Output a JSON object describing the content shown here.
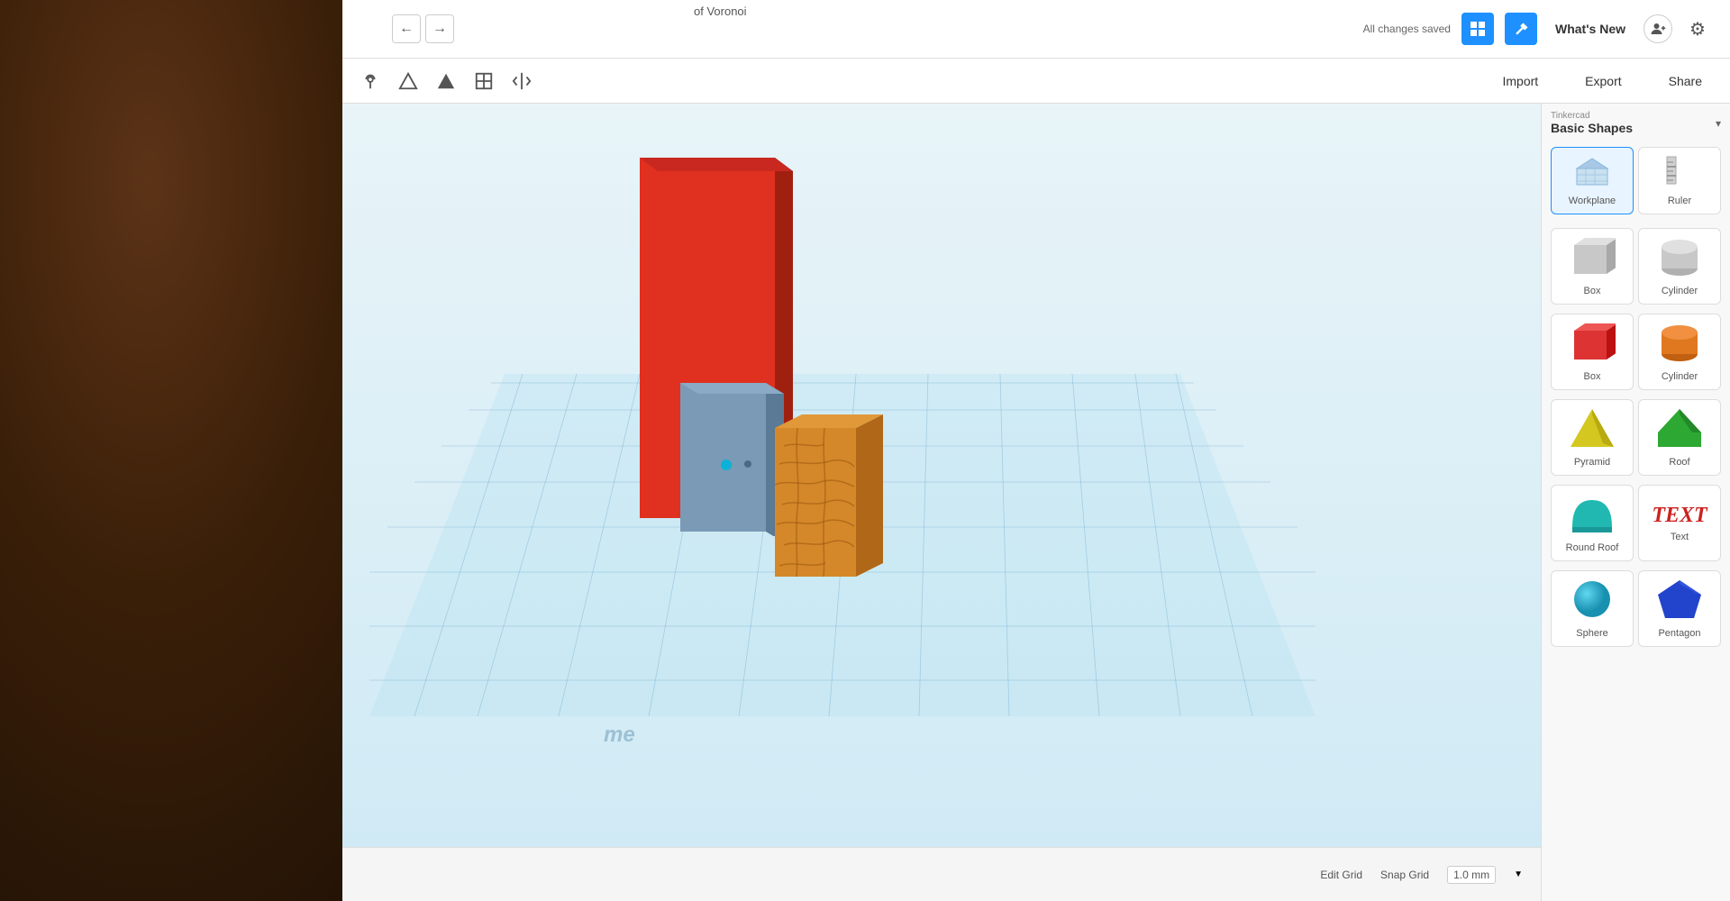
{
  "app": {
    "title": "Tinkercad",
    "breadcrumb": "of Voronoi",
    "saved_status": "All changes saved",
    "whats_new_label": "What's New",
    "import_label": "Import",
    "export_label": "Export",
    "share_label": "Share"
  },
  "toolbar2": {
    "tools": [
      {
        "name": "pin",
        "symbol": "📌"
      },
      {
        "name": "triangle-outline",
        "symbol": "△"
      },
      {
        "name": "triangle-solid",
        "symbol": "▲"
      },
      {
        "name": "align",
        "symbol": "⊡"
      },
      {
        "name": "flip",
        "symbol": "⇅"
      }
    ]
  },
  "panel": {
    "provider": "Tinkercad",
    "category": "Basic Shapes",
    "dropdown_arrow": "▾",
    "tools": [
      {
        "id": "workplane",
        "label": "Workplane",
        "active": true
      },
      {
        "id": "ruler",
        "label": "Ruler",
        "active": false
      }
    ],
    "shapes": [
      {
        "id": "box-gray",
        "label": "Box",
        "type": "box-gray"
      },
      {
        "id": "cylinder-gray",
        "label": "Cylinder",
        "type": "cylinder-gray"
      },
      {
        "id": "box-red",
        "label": "Box",
        "type": "box-red"
      },
      {
        "id": "cylinder-orange",
        "label": "Cylinder",
        "type": "cylinder-orange"
      },
      {
        "id": "pyramid",
        "label": "Pyramid",
        "type": "pyramid"
      },
      {
        "id": "roof",
        "label": "Roof",
        "type": "roof"
      },
      {
        "id": "round-roof",
        "label": "Round Roof",
        "type": "round-roof"
      },
      {
        "id": "text",
        "label": "Text",
        "type": "text"
      },
      {
        "id": "sphere",
        "label": "Sphere",
        "type": "sphere"
      },
      {
        "id": "pentagon",
        "label": "Pentagon",
        "type": "pentagon"
      }
    ]
  },
  "status": {
    "edit_grid_label": "Edit Grid",
    "snap_grid_label": "Snap Grid",
    "snap_grid_value": "1.0 mm",
    "arrow_down": "▼"
  },
  "viewport": {
    "grid_label": "me"
  }
}
